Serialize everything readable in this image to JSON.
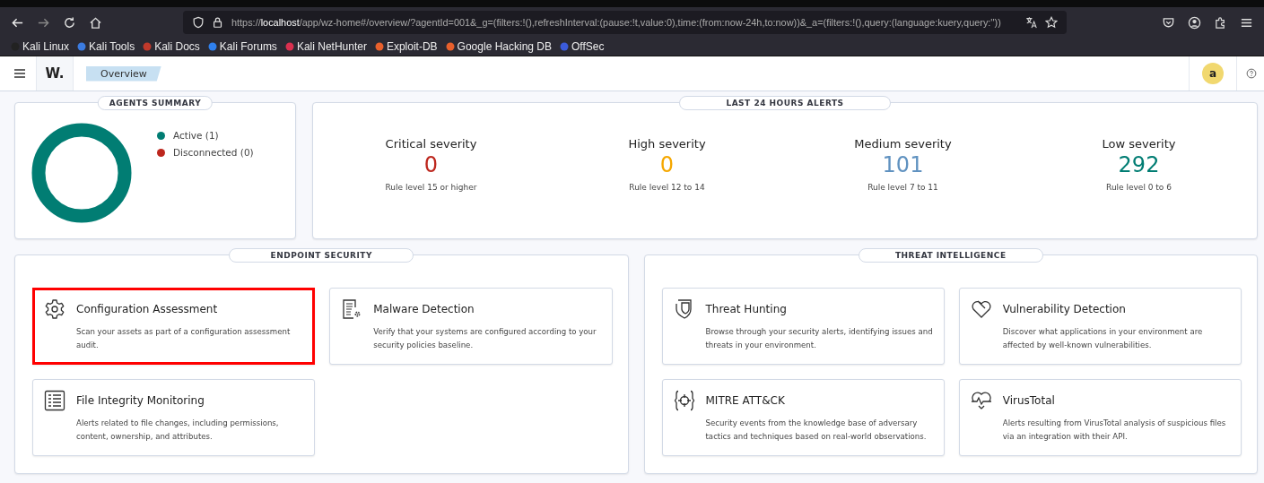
{
  "browser": {
    "url": "https://**localhost**/app/wz-home#/overview/?agentId=001&_g=(filters:!(),refreshInterval:(pause:!t,value:0),time:(from:now-24h,to:now))&_a=(filters:!(),query:(language:kuery,query:''))",
    "bookmarks": [
      "Kali Linux",
      "Kali Tools",
      "Kali Docs",
      "Kali Forums",
      "Kali NetHunter",
      "Exploit-DB",
      "Google Hacking DB",
      "OffSec"
    ]
  },
  "header": {
    "logo": "W.",
    "breadcrumb": "Overview",
    "avatar": "a"
  },
  "agents_summary": {
    "title": "AGENTS SUMMARY",
    "legend": [
      {
        "label": "Active (1)",
        "color": "#017d73"
      },
      {
        "label": "Disconnected (0)",
        "color": "#bd271e"
      }
    ]
  },
  "alerts": {
    "title": "LAST 24 HOURS ALERTS",
    "items": [
      {
        "label": "Critical severity",
        "value": "0",
        "color": "#bd271e",
        "note": "Rule level 15 or higher"
      },
      {
        "label": "High severity",
        "value": "0",
        "color": "#f5a700",
        "note": "Rule level 12 to 14"
      },
      {
        "label": "Medium severity",
        "value": "101",
        "color": "#6092c0",
        "note": "Rule level 7 to 11"
      },
      {
        "label": "Low severity",
        "value": "292",
        "color": "#017d73",
        "note": "Rule level 0 to 6"
      }
    ]
  },
  "sections": [
    {
      "title": "ENDPOINT SECURITY",
      "cards": [
        {
          "title": "Configuration Assessment",
          "text": "Scan your assets as part of a configuration assessment audit.",
          "highlighted": true
        },
        {
          "title": "Malware Detection",
          "text": "Verify that your systems are configured according to your security policies baseline.",
          "highlighted": false
        },
        {
          "title": "File Integrity Monitoring",
          "text": "Alerts related to file changes, including permissions, content, ownership, and attributes.",
          "highlighted": false
        }
      ]
    },
    {
      "title": "THREAT INTELLIGENCE",
      "cards": [
        {
          "title": "Threat Hunting",
          "text": "Browse through your security alerts, identifying issues and threats in your environment.",
          "highlighted": false
        },
        {
          "title": "Vulnerability Detection",
          "text": "Discover what applications in your environment are affected by well-known vulnerabilities.",
          "highlighted": false
        },
        {
          "title": "MITRE ATT&CK",
          "text": "Security events from the knowledge base of adversary tactics and techniques based on real-world observations.",
          "highlighted": false
        },
        {
          "title": "VirusTotal",
          "text": "Alerts resulting from VirusTotal analysis of suspicious files via an integration with their API.",
          "highlighted": false
        }
      ]
    }
  ]
}
